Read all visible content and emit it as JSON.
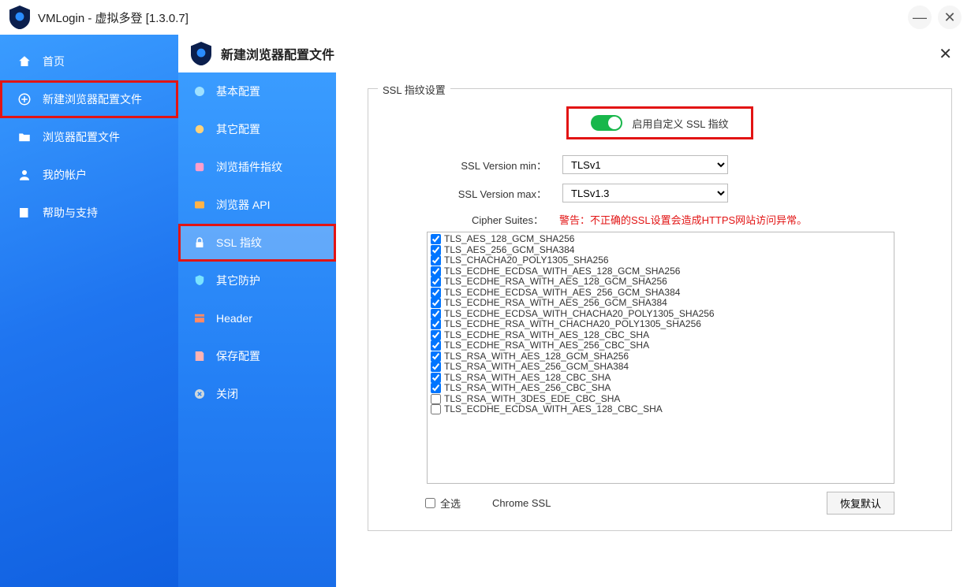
{
  "window": {
    "title": "VMLogin - 虚拟多登 [1.3.0.7]"
  },
  "sidebar_main": {
    "items": [
      {
        "label": "首页"
      },
      {
        "label": "新建浏览器配置文件"
      },
      {
        "label": "浏览器配置文件"
      },
      {
        "label": "我的帐户"
      },
      {
        "label": "帮助与支持"
      }
    ]
  },
  "dialog": {
    "title": "新建浏览器配置文件",
    "sidebar": {
      "items": [
        {
          "label": "基本配置"
        },
        {
          "label": "其它配置"
        },
        {
          "label": "浏览插件指纹"
        },
        {
          "label": "浏览器 API"
        },
        {
          "label": "SSL 指纹"
        },
        {
          "label": "其它防护"
        },
        {
          "label": "Header"
        },
        {
          "label": "保存配置"
        },
        {
          "label": "关闭"
        }
      ]
    },
    "content": {
      "legend": "SSL 指纹设置",
      "toggle_label": "启用自定义 SSL 指纹",
      "version_min_label": "SSL Version min：",
      "version_max_label": "SSL Version max：",
      "version_min_value": "TLSv1",
      "version_max_value": "TLSv1.3",
      "cipher_label": "Cipher Suites：",
      "warning": "警告：不正确的SSL设置会造成HTTPS网站访问异常。",
      "ciphers": [
        {
          "name": "TLS_AES_128_GCM_SHA256",
          "checked": true
        },
        {
          "name": "TLS_AES_256_GCM_SHA384",
          "checked": true
        },
        {
          "name": "TLS_CHACHA20_POLY1305_SHA256",
          "checked": true
        },
        {
          "name": "TLS_ECDHE_ECDSA_WITH_AES_128_GCM_SHA256",
          "checked": true
        },
        {
          "name": "TLS_ECDHE_RSA_WITH_AES_128_GCM_SHA256",
          "checked": true
        },
        {
          "name": "TLS_ECDHE_ECDSA_WITH_AES_256_GCM_SHA384",
          "checked": true
        },
        {
          "name": "TLS_ECDHE_RSA_WITH_AES_256_GCM_SHA384",
          "checked": true
        },
        {
          "name": "TLS_ECDHE_ECDSA_WITH_CHACHA20_POLY1305_SHA256",
          "checked": true
        },
        {
          "name": "TLS_ECDHE_RSA_WITH_CHACHA20_POLY1305_SHA256",
          "checked": true
        },
        {
          "name": "TLS_ECDHE_RSA_WITH_AES_128_CBC_SHA",
          "checked": true
        },
        {
          "name": "TLS_ECDHE_RSA_WITH_AES_256_CBC_SHA",
          "checked": true
        },
        {
          "name": "TLS_RSA_WITH_AES_128_GCM_SHA256",
          "checked": true
        },
        {
          "name": "TLS_RSA_WITH_AES_256_GCM_SHA384",
          "checked": true
        },
        {
          "name": "TLS_RSA_WITH_AES_128_CBC_SHA",
          "checked": true
        },
        {
          "name": "TLS_RSA_WITH_AES_256_CBC_SHA",
          "checked": true
        },
        {
          "name": "TLS_RSA_WITH_3DES_EDE_CBC_SHA",
          "checked": false
        },
        {
          "name": "TLS_ECDHE_ECDSA_WITH_AES_128_CBC_SHA",
          "checked": false
        }
      ],
      "select_all_label": "全选",
      "chrome_ssl_label": "Chrome SSL",
      "reset_label": "恢复默认"
    }
  }
}
